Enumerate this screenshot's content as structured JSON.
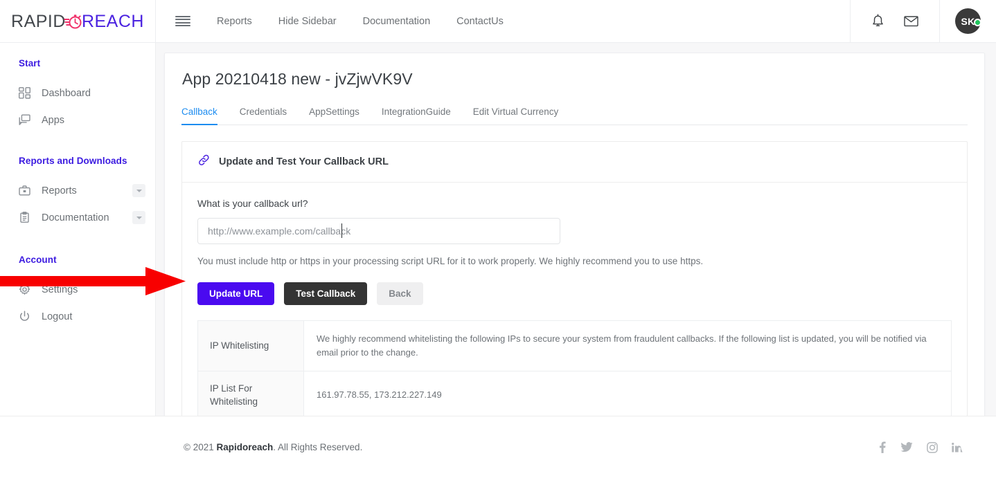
{
  "brand": {
    "part1": "RAPID",
    "part2": "REACH",
    "mark": "stopwatch-icon"
  },
  "topnav": {
    "menu_icon": "hamburger-icon",
    "links": [
      {
        "label": "Reports"
      },
      {
        "label": "Hide Sidebar"
      },
      {
        "label": "Documentation"
      },
      {
        "label": "ContactUs"
      }
    ],
    "notification_icon": "bell-icon",
    "mail_icon": "envelope-icon",
    "avatar_initials": "SK",
    "status": "online"
  },
  "sidebar": {
    "sections": [
      {
        "heading": "Start",
        "items": [
          {
            "label": "Dashboard",
            "icon": "grid-icon",
            "caret": false
          },
          {
            "label": "Apps",
            "icon": "apps-window-icon",
            "caret": false
          }
        ]
      },
      {
        "heading": "Reports and Downloads",
        "items": [
          {
            "label": "Reports",
            "icon": "briefcase-icon",
            "caret": true
          },
          {
            "label": "Documentation",
            "icon": "clipboard-icon",
            "caret": true
          }
        ]
      },
      {
        "heading": "Account",
        "items": [
          {
            "label": "Settings",
            "icon": "gear-icon",
            "caret": false
          },
          {
            "label": "Logout",
            "icon": "power-icon",
            "caret": false
          }
        ]
      }
    ]
  },
  "page": {
    "title": "App 20210418 new - jvZjwVK9V",
    "tabs": [
      {
        "label": "Callback",
        "active": true
      },
      {
        "label": "Credentials",
        "active": false
      },
      {
        "label": "AppSettings",
        "active": false
      },
      {
        "label": "IntegrationGuide",
        "active": false
      },
      {
        "label": "Edit Virtual Currency",
        "active": false
      }
    ]
  },
  "callback_card": {
    "icon": "link-icon",
    "title": "Update and Test Your Callback URL",
    "field_label": "What is your callback url?",
    "input_placeholder": "http://www.example.com/callback",
    "input_value": "",
    "helper_text": "You must include http or https in your processing script URL for it to work properly. We highly recommend you to use https.",
    "buttons": {
      "update": "Update URL",
      "test": "Test Callback",
      "back": "Back"
    },
    "table": [
      {
        "key": "IP Whitelisting",
        "value": "We highly recommend whitelisting the following IPs to secure your system from fraudulent callbacks. If the following list is updated, you will be notified via email prior to the change."
      },
      {
        "key": "IP List For Whitelisting",
        "value": "161.97.78.55, 173.212.227.149"
      }
    ]
  },
  "footer": {
    "copyright_prefix": "© 2021 ",
    "copyright_brand": "Rapidoreach",
    "copyright_suffix": ". All Rights Reserved.",
    "socials": [
      {
        "name": "facebook-icon"
      },
      {
        "name": "twitter-icon"
      },
      {
        "name": "instagram-icon"
      },
      {
        "name": "linkedin-icon"
      }
    ]
  },
  "annotation": {
    "type": "red-arrow",
    "points_to": "Update URL",
    "color": "#f80000"
  },
  "colors": {
    "accent_blue": "#1c8cf0",
    "sidebar_heading": "#3b1ae0",
    "primary_button": "#4a0af0",
    "dark_button": "#343434",
    "brand_purple": "#4b23e0",
    "brand_pink": "#f0326b",
    "online_green": "#21c55d",
    "annotation_red": "#f80000"
  }
}
